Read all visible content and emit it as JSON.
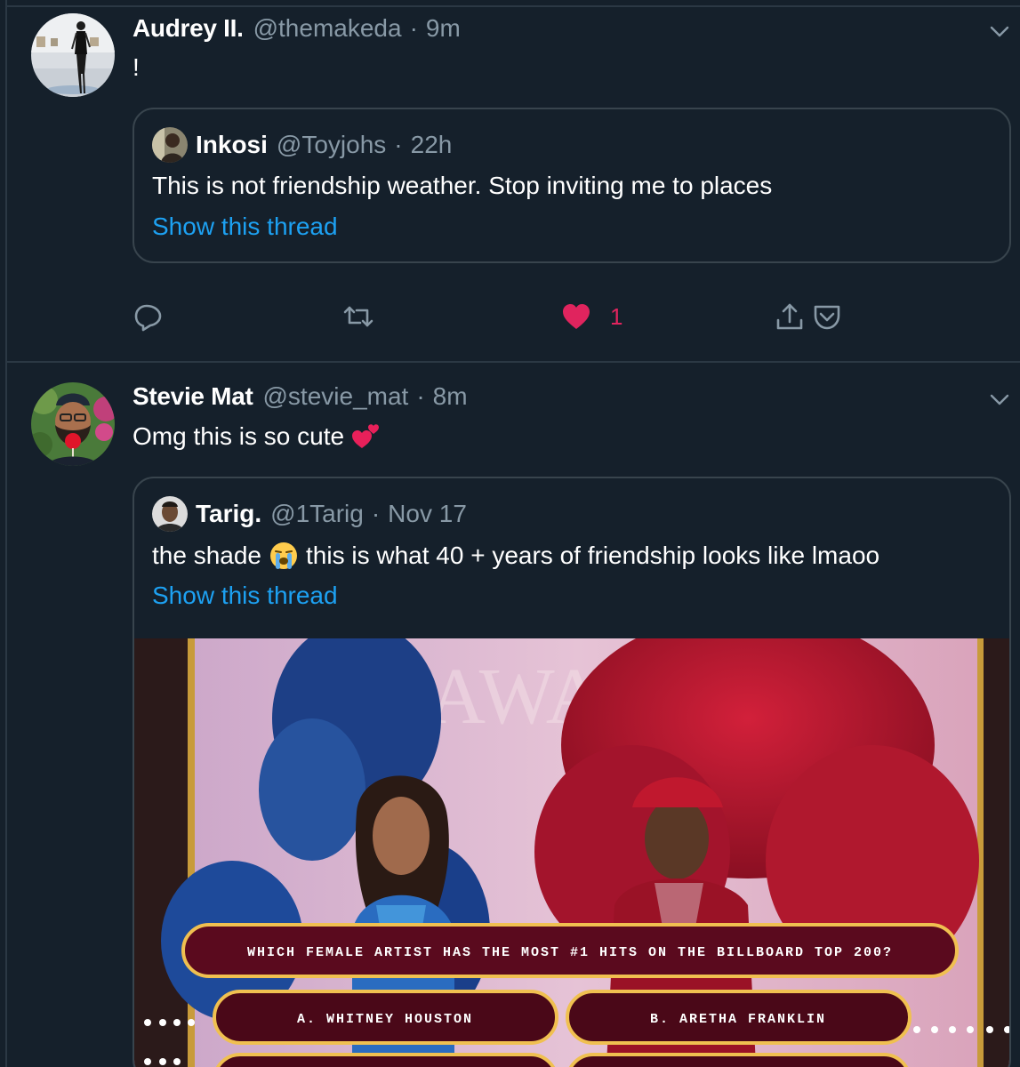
{
  "tweets": [
    {
      "author": {
        "name": "Audrey II.",
        "handle": "@themakeda"
      },
      "separator": "·",
      "time": "9m",
      "text": "!",
      "quote": {
        "author": {
          "name": "Inkosi",
          "handle": "@Toyjohs"
        },
        "separator": "·",
        "time": "22h",
        "text": "This is not friendship weather. Stop inviting me to places",
        "thread_link": "Show this thread"
      },
      "actions": {
        "like_count": "1",
        "liked": true
      }
    },
    {
      "author": {
        "name": "Stevie Mat",
        "handle": "@stevie_mat"
      },
      "separator": "·",
      "time": "8m",
      "text": "Omg this is so cute",
      "text_emoji": "two-hearts-emoji",
      "quote": {
        "author": {
          "name": "Tarig.",
          "handle": "@1Tarig"
        },
        "separator": "·",
        "time": "Nov 17",
        "text_before": "the shade",
        "text_emoji": "crying-face-emoji",
        "text_after": "this is what 40 + years of friendship looks like lmaoo",
        "thread_link": "Show this thread",
        "media": {
          "question": "WHICH FEMALE ARTIST HAS THE MOST #1 HITS ON THE BILLBOARD TOP 200?",
          "answer_a": "A. WHITNEY HOUSTON",
          "answer_b": "B. ARETHA FRANKLIN"
        }
      }
    }
  ],
  "colors": {
    "background": "#15202b",
    "border": "#38444d",
    "secondary_text": "#8899a6",
    "link": "#1da1f2",
    "like": "#e0245e"
  }
}
